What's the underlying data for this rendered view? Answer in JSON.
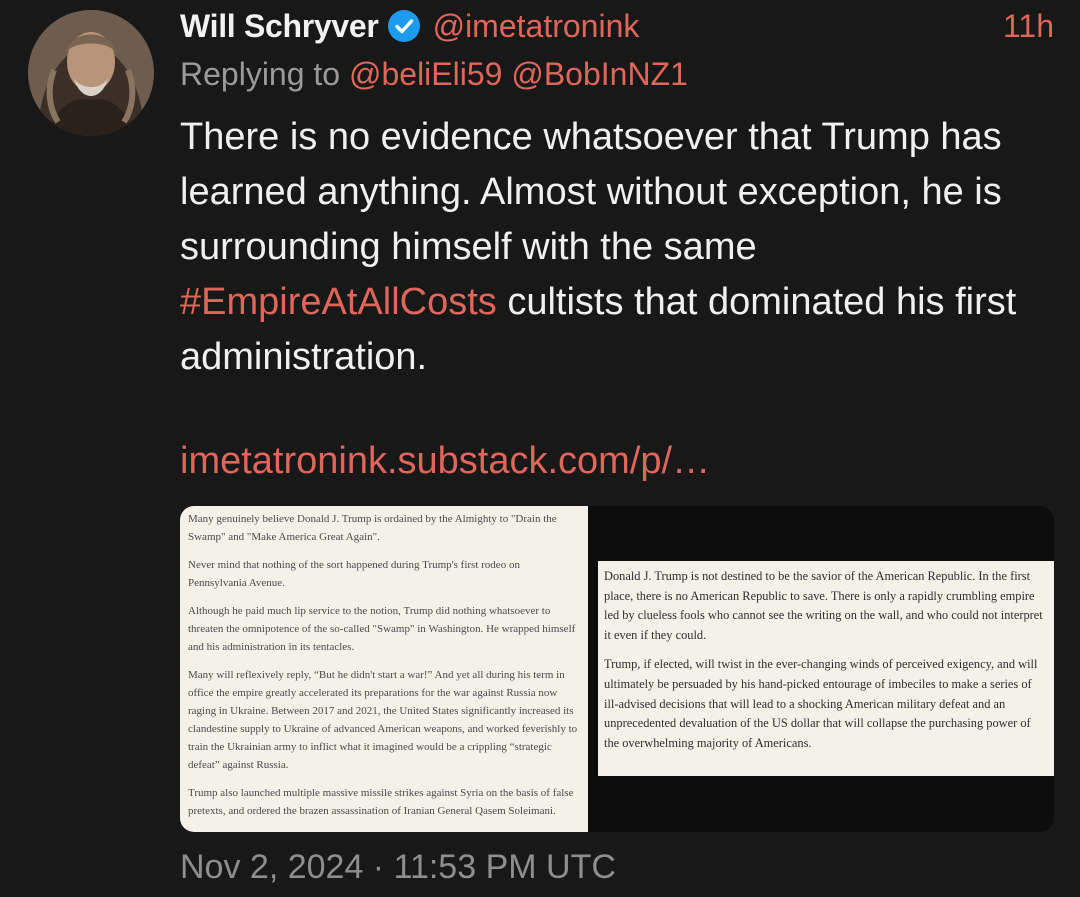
{
  "tweet": {
    "author_name": "Will Schryver",
    "handle": "@imetatronink",
    "time_ago": "11h",
    "verified": true,
    "reply_prefix": "Replying to",
    "reply_to": [
      "@beliEli59",
      "@BobInNZ1"
    ],
    "text_part1": "There is no evidence whatsoever that Trump has learned anything. Almost without exception, he is surrounding himself with the same",
    "hashtag": "#EmpireAtAllCosts",
    "text_part2": "cultists that dominated his first administration.",
    "link": "imetatronink.substack.com/p/…",
    "date": "Nov 2, 2024 · 11:53 PM UTC"
  },
  "media": {
    "left_paragraphs": [
      "Many genuinely believe Donald J. Trump is ordained by the Almighty to \"Drain the Swamp\" and \"Make America Great Again\".",
      "Never mind that nothing of the sort happened during Trump's first rodeo on Pennsylvania Avenue.",
      "Although he paid much lip service to the notion, Trump did nothing whatsoever to threaten the omnipotence of the so-called \"Swamp\" in Washington. He wrapped himself and his administration in its tentacles.",
      "Many will reflexively reply, “But he didn't start a war!” And yet all during his term in office the empire greatly accelerated its preparations for the war against Russia now raging in Ukraine. Between 2017 and 2021, the United States significantly increased its clandestine supply to Ukraine of advanced American weapons, and worked feverishly to train the Ukrainian army to inflict what it imagined would be a crippling “strategic defeat” against Russia.",
      "Trump also launched multiple massive missile strikes against Syria on the basis of false pretexts, and ordered the brazen assassination of Iranian General Qasem Soleimani."
    ],
    "right_paragraphs": [
      "Donald J. Trump is not destined to be the savior of the American Republic. In the first place, there is no American Republic to save. There is only a rapidly crumbling empire led by clueless fools who cannot see the writing on the wall, and who could not interpret it even if they could.",
      "Trump, if elected, will twist in the ever-changing winds of perceived exigency, and will ultimately be persuaded by his hand-picked entourage of imbeciles to make a series of ill-advised decisions that will lead to a shocking American military defeat and an unprecedented devaluation of the US dollar that will collapse the purchasing power of the overwhelming majority of Americans."
    ]
  },
  "colors": {
    "background": "#181818",
    "accent": "#e0665a",
    "verified": "#1d9bf0",
    "muted": "#9a9a9a"
  },
  "icons": {
    "verified": "verified-badge-icon"
  }
}
